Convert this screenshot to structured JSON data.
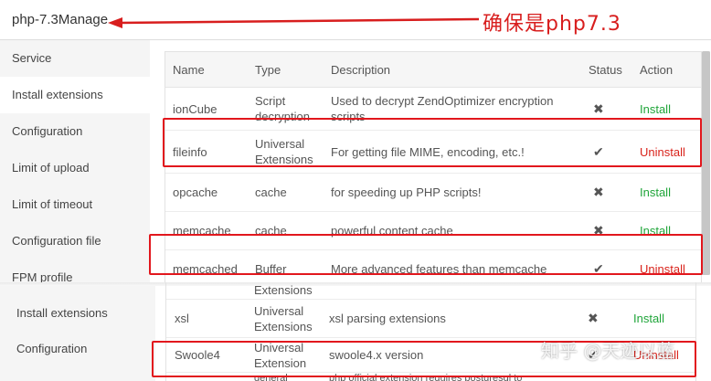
{
  "window": {
    "title": "php-7.3Manage"
  },
  "annotation": {
    "text": "确保是php7.3"
  },
  "sidebar": {
    "items": [
      {
        "label": "Service"
      },
      {
        "label": "Install extensions"
      },
      {
        "label": "Configuration"
      },
      {
        "label": "Limit of upload"
      },
      {
        "label": "Limit of timeout"
      },
      {
        "label": "Configuration file"
      },
      {
        "label": "FPM profile"
      }
    ],
    "active_index": 1
  },
  "table": {
    "headers": {
      "name": "Name",
      "type": "Type",
      "description": "Description",
      "status": "Status",
      "action": "Action"
    },
    "rows": [
      {
        "name": "ionCube",
        "type": "Script decryption",
        "description": "Used to decrypt ZendOptimizer encryption scripts",
        "status": "✖",
        "action": "Install"
      },
      {
        "name": "fileinfo",
        "type": "Universal Extensions",
        "description": "For getting file MIME, encoding, etc.!",
        "status": "✔",
        "action": "Uninstall"
      },
      {
        "name": "opcache",
        "type": "cache",
        "description": "for speeding up PHP scripts!",
        "status": "✖",
        "action": "Install"
      },
      {
        "name": "memcache",
        "type": "cache",
        "description": "powerful content cache",
        "status": "✖",
        "action": "Install"
      },
      {
        "name": "memcached",
        "type": "Buffer",
        "description": "More advanced features than memcache",
        "status": "✔",
        "action": "Uninstall"
      }
    ]
  },
  "lower": {
    "sidebar": {
      "items": [
        {
          "label": "Install extensions"
        },
        {
          "label": "Configuration"
        }
      ]
    },
    "partial_type": "Extensions",
    "rows": [
      {
        "name": "xsl",
        "type": "Universal Extensions",
        "description": "xsl parsing extensions",
        "status": "✖",
        "action": "Install"
      },
      {
        "name": "Swoole4",
        "type": "Universal Extension",
        "description": "swoole4.x version",
        "status": "✔",
        "action": "Uninstall"
      }
    ],
    "cut_row": {
      "type": "general",
      "description": "php official extension requires postgresql to"
    }
  },
  "watermark": {
    "text": "知乎 @天迹以蓝"
  },
  "colors": {
    "install": "#20a53a",
    "uninstall": "#d9231b",
    "highlight": "#e2171d",
    "sidebar_bg": "#f5f5f5"
  }
}
